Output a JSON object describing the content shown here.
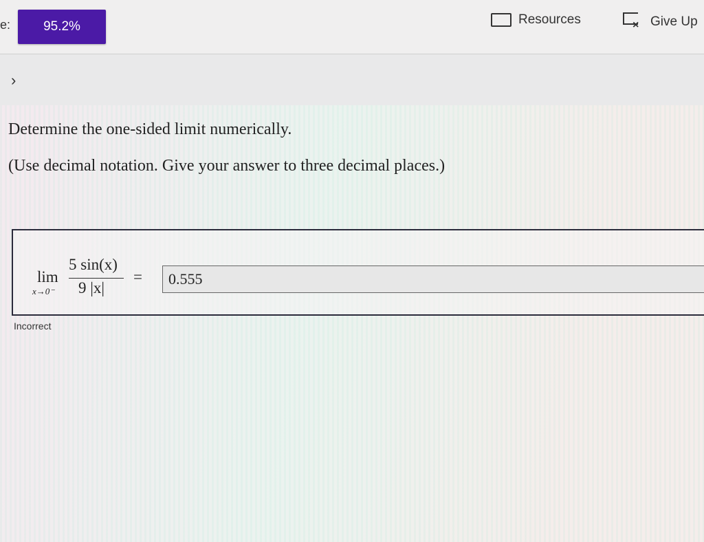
{
  "header": {
    "score_prefix": "e:",
    "score": "95.2%",
    "resources_label": "Resources",
    "give_up_label": "Give Up"
  },
  "nav": {
    "chevron": "›"
  },
  "question": {
    "instruction": "Determine the one-sided limit numerically.",
    "note": "(Use decimal notation. Give your answer to three decimal places.)"
  },
  "expression": {
    "lim": "lim",
    "approach": "x→0⁻",
    "numerator": "5 sin(x)",
    "denominator": "9 |x|",
    "equals": "="
  },
  "answer": {
    "value": "0.555",
    "feedback": "Incorrect"
  },
  "colors": {
    "score_bg": "#4b1aa6"
  }
}
